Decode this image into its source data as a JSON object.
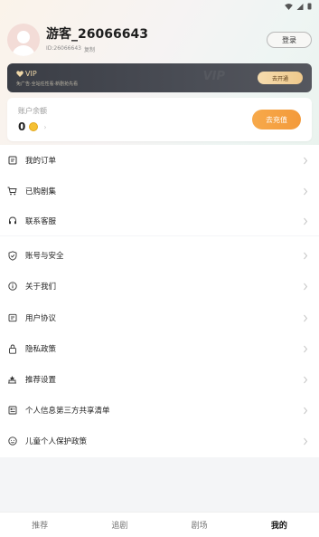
{
  "profile": {
    "username": "游客_26066643",
    "uid_text": "ID:26066643",
    "copy_label": "复制",
    "login_label": "登录"
  },
  "vip": {
    "title": "VIP",
    "description": "免广告·全站任性看·新剧抢先看",
    "button_label": "去开通",
    "watermark": "VIP"
  },
  "balance": {
    "label": "账户余额",
    "value": "0",
    "recharge_label": "去充值"
  },
  "menu": {
    "group1": [
      {
        "label": "我的订单",
        "icon": "order-icon"
      },
      {
        "label": "已购剧集",
        "icon": "cart-icon"
      },
      {
        "label": "联系客服",
        "icon": "headset-icon"
      }
    ],
    "group2": [
      {
        "label": "账号与安全",
        "icon": "shield-icon"
      },
      {
        "label": "关于我们",
        "icon": "info-icon"
      },
      {
        "label": "用户协议",
        "icon": "agreement-icon"
      },
      {
        "label": "隐私政策",
        "icon": "lock-icon"
      },
      {
        "label": "推荐设置",
        "icon": "recommend-icon"
      },
      {
        "label": "个人信息第三方共享清单",
        "icon": "list-icon"
      },
      {
        "label": "儿童个人保护政策",
        "icon": "child-icon"
      }
    ]
  },
  "tabs": [
    {
      "label": "推荐",
      "active": false
    },
    {
      "label": "追剧",
      "active": false
    },
    {
      "label": "剧场",
      "active": false
    },
    {
      "label": "我的",
      "active": true
    }
  ],
  "colors": {
    "accent": "#f39a3b",
    "vip_bg": "#3a3d45",
    "vip_gold": "#f0d8a8"
  }
}
